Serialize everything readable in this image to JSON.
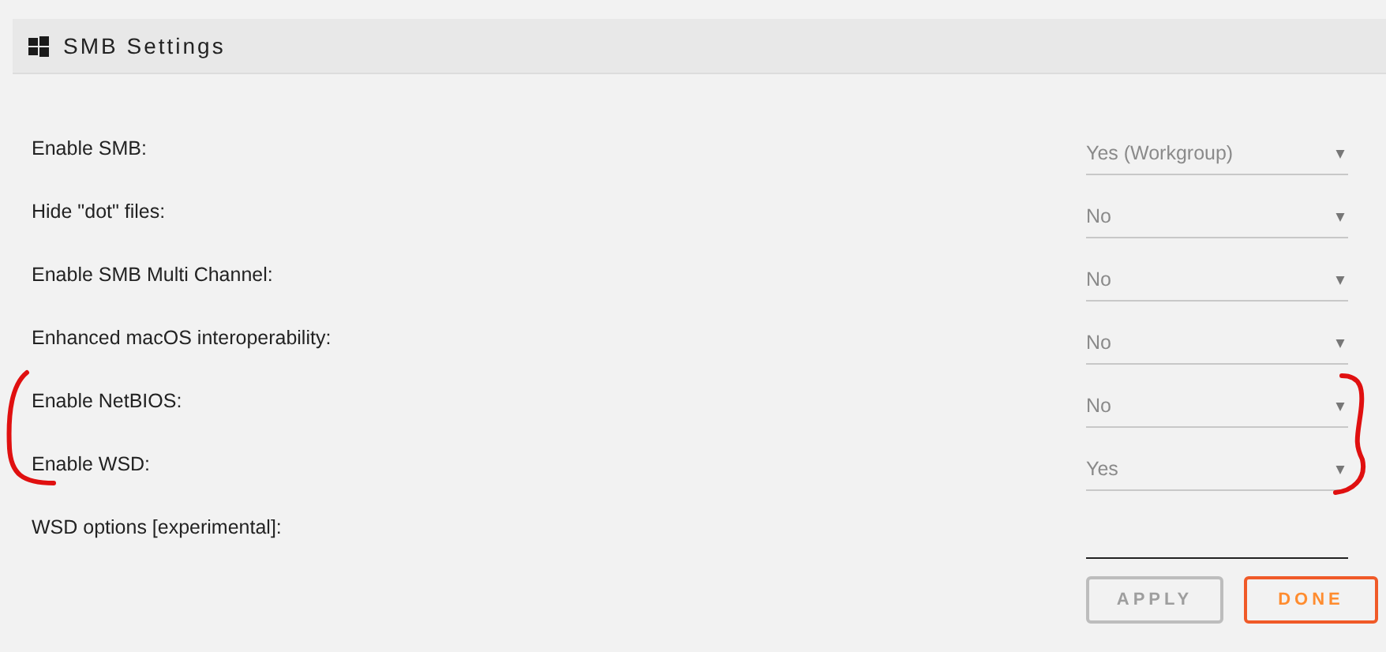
{
  "panel": {
    "title": "SMB Settings"
  },
  "settings": [
    {
      "kind": "select",
      "label": "Enable SMB:",
      "value": "Yes (Workgroup)"
    },
    {
      "kind": "select",
      "label": "Hide \"dot\" files:",
      "value": "No"
    },
    {
      "kind": "select",
      "label": "Enable SMB Multi Channel:",
      "value": "No"
    },
    {
      "kind": "select",
      "label": "Enhanced macOS interoperability:",
      "value": "No"
    },
    {
      "kind": "select",
      "label": "Enable NetBIOS:",
      "value": "No"
    },
    {
      "kind": "select",
      "label": "Enable WSD:",
      "value": "Yes"
    },
    {
      "kind": "text",
      "label": "WSD options [experimental]:"
    }
  ],
  "buttons": [
    {
      "label": "APPLY",
      "kind": "apply",
      "disabled": true
    },
    {
      "label": "DONE",
      "kind": "done",
      "disabled": false
    }
  ]
}
